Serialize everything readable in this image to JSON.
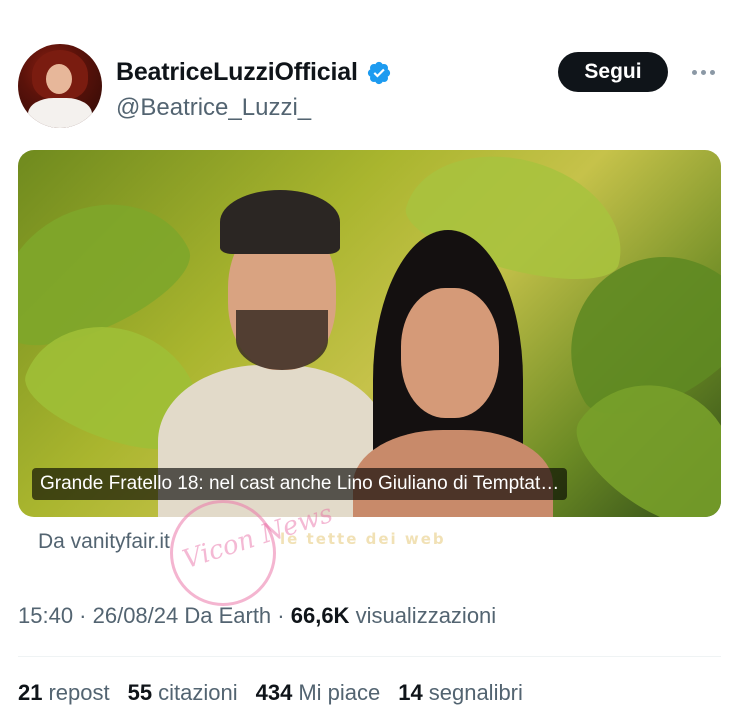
{
  "author": {
    "display_name": "BeatriceLuzziOfficial",
    "handle": "@Beatrice_Luzzi_",
    "verified": true
  },
  "follow_button": {
    "label": "Segui"
  },
  "link_card": {
    "headline": "Grande Fratello 18: nel cast anche Lino Giuliano di Temptat…",
    "source": "Da vanityfair.it"
  },
  "meta": {
    "time_date_source": "15:40 · 26/08/24 Da Earth · ",
    "views_count": "66,6K",
    "views_label": " visualizzazioni"
  },
  "stats": [
    {
      "count": "21",
      "label": "repost"
    },
    {
      "count": "55",
      "label": "citazioni"
    },
    {
      "count": "434",
      "label": "Mi piace"
    },
    {
      "count": "14",
      "label": "segnalibri"
    }
  ],
  "watermark": {
    "logo_text": "Vicon News",
    "strip_text": "le tette dei web"
  },
  "colors": {
    "text_primary": "#0f1419",
    "text_secondary": "#536471",
    "verified_blue": "#1d9bf0",
    "button_bg": "#0f1419"
  },
  "icons": [
    "verified-badge-icon",
    "more-options-icon"
  ]
}
